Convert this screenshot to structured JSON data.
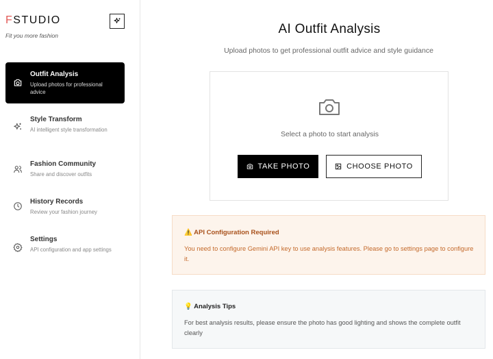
{
  "brand": {
    "first_letter": "F",
    "rest": "STUDIO",
    "tagline": "Fit you more fashion",
    "accent": "#e25a57"
  },
  "sidebar": {
    "items": [
      {
        "title": "Outfit Analysis",
        "desc": "Upload photos for professional advice",
        "icon": "camera-icon",
        "active": true
      },
      {
        "title": "Style Transform",
        "desc": "AI intelligent style transformation",
        "icon": "sparkles-icon",
        "active": false
      },
      {
        "title": "Fashion Community",
        "desc": "Share and discover outfits",
        "icon": "users-icon",
        "active": false
      },
      {
        "title": "History Records",
        "desc": "Review your fashion journey",
        "icon": "clock-icon",
        "active": false
      },
      {
        "title": "Settings",
        "desc": "API configuration and app settings",
        "icon": "gear-icon",
        "active": false
      }
    ]
  },
  "main": {
    "title": "AI Outfit Analysis",
    "subtitle": "Upload photos to get professional outfit advice and style guidance",
    "upload": {
      "prompt": "Select a photo to start analysis",
      "take_photo": "TAKE PHOTO",
      "choose_photo": "CHOOSE PHOTO"
    },
    "alert": {
      "title": "⚠️ API Configuration Required",
      "text": "You need to configure Gemini API key to use analysis features. Please go to settings page to configure it."
    },
    "tips": {
      "title": "💡 Analysis Tips",
      "text": "For best analysis results, please ensure the photo has good lighting and shows the complete outfit clearly"
    }
  }
}
